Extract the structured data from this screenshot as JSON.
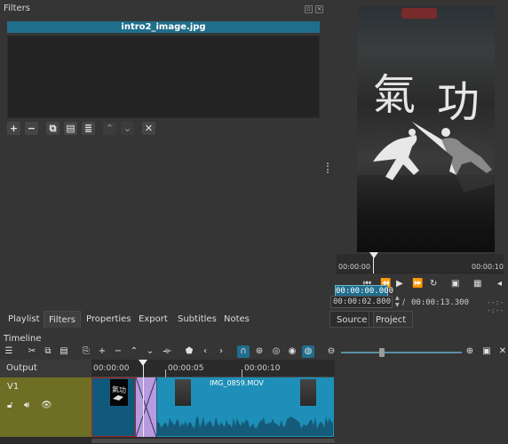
{
  "filters_panel": {
    "title": "Filters",
    "header": "intro2_image.jpg",
    "toolbar": [
      "add-icon",
      "remove-icon",
      "copy-icon",
      "paste-icon",
      "save-preset-icon",
      "move-up-icon",
      "move-down-icon",
      "deselect-icon"
    ]
  },
  "preview": {
    "overlay_text_left": "氣",
    "overlay_text_right": "功",
    "ruler_start": "00:00:00",
    "ruler_end": "00:00:10"
  },
  "transport": {
    "current_timecode": "00:00:00.000",
    "position_field": "00:00:02.800",
    "separator": "/",
    "duration": "00:00:13.300",
    "in_out_placeholder": "--:--:--"
  },
  "tabs": {
    "left": [
      "Playlist",
      "Filters",
      "Properties",
      "Export",
      "Subtitles",
      "Notes"
    ],
    "active": "Filters",
    "right": [
      "Source",
      "Project"
    ],
    "right_active": "Source"
  },
  "timeline": {
    "title": "Timeline",
    "output_label": "Output",
    "ruler_ticks": [
      "00:00:00",
      "00:00:05",
      "00:00:10"
    ],
    "track_name": "V1",
    "clip_name": "IMG_0859.MOV"
  },
  "colors": {
    "accent": "#1f6e8c",
    "track_head": "#6e6e24",
    "clip": "#1e8fb8",
    "transition": "#b79be0"
  }
}
